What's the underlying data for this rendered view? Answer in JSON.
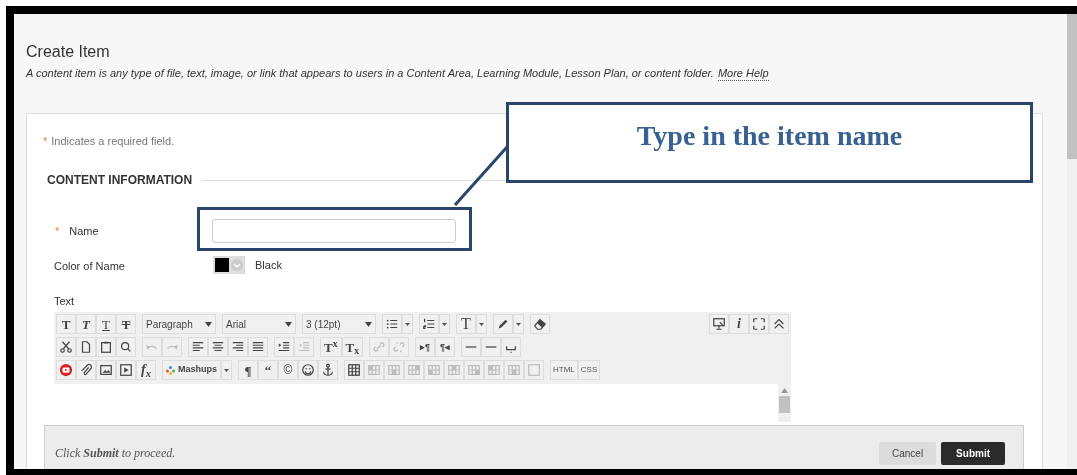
{
  "page": {
    "title": "Create Item",
    "description": "A content item is any type of file, text, image, or link that appears to users in a Content Area, Learning Module, Lesson Plan, or content folder.",
    "help_link": "More Help"
  },
  "form": {
    "required_mark": "*",
    "required_note": "Indicates a required field.",
    "section_title": "CONTENT INFORMATION",
    "name_field": {
      "required_mark": "*",
      "label": "Name"
    },
    "color_field": {
      "label": "Color of Name",
      "color": "#000000",
      "value": "Black"
    },
    "text_field": {
      "label": "Text"
    }
  },
  "toolbar": {
    "rows": [
      {
        "left": [
          {
            "items": [
              {
                "kind": "glyph",
                "text": "T"
              },
              {
                "kind": "glyph",
                "text": "T"
              },
              {
                "kind": "glyph",
                "text": "T"
              },
              {
                "kind": "glyph",
                "text": "T"
              }
            ]
          },
          {
            "items": [
              {
                "kind": "dropdown",
                "text": "Paragraph"
              }
            ]
          },
          {
            "items": [
              {
                "kind": "dropdown",
                "text": "Arial"
              }
            ]
          },
          {
            "items": [
              {
                "kind": "dropdown",
                "text": "3 (12pt)"
              }
            ]
          },
          {
            "items": [
              {
                "kind": "icon",
                "disabled": false
              },
              {
                "kind": "caret"
              }
            ]
          },
          {
            "items": [
              {
                "kind": "icon",
                "disabled": false
              },
              {
                "kind": "caret"
              }
            ]
          },
          {
            "items": [
              {
                "kind": "glyph",
                "text": "T"
              },
              {
                "kind": "caret"
              }
            ]
          },
          {
            "items": [
              {
                "kind": "icon",
                "disabled": false
              },
              {
                "kind": "caret"
              }
            ]
          },
          {
            "items": [
              {
                "kind": "icon",
                "disabled": false
              }
            ]
          }
        ],
        "right": [
          {
            "items": [
              {
                "kind": "icon",
                "disabled": false
              },
              {
                "kind": "glyph",
                "text": "i"
              },
              {
                "kind": "icon",
                "disabled": false
              },
              {
                "kind": "icon",
                "disabled": false
              }
            ]
          }
        ]
      },
      {
        "left": [
          {
            "items": [
              {
                "kind": "icon",
                "disabled": false
              },
              {
                "kind": "icon",
                "disabled": false
              },
              {
                "kind": "icon",
                "disabled": false
              },
              {
                "kind": "icon",
                "disabled": false
              }
            ]
          },
          {
            "items": [
              {
                "kind": "icon",
                "disabled": true
              },
              {
                "kind": "icon",
                "disabled": true
              }
            ]
          },
          {
            "items": [
              {
                "kind": "icon",
                "disabled": false
              },
              {
                "kind": "icon",
                "disabled": false
              },
              {
                "kind": "icon",
                "disabled": false
              },
              {
                "kind": "icon",
                "disabled": false
              }
            ]
          },
          {
            "items": [
              {
                "kind": "icon",
                "disabled": false
              },
              {
                "kind": "icon",
                "disabled": true
              }
            ]
          },
          {
            "items": [
              {
                "kind": "glyph",
                "text": "T$^{x}$"
              },
              {
                "kind": "glyph",
                "text": "T$_{x}$"
              }
            ]
          },
          {
            "items": [
              {
                "kind": "icon",
                "disabled": true
              },
              {
                "kind": "icon",
                "disabled": true
              }
            ]
          },
          {
            "items": [
              {
                "kind": "glyph",
                "text": "▸¶"
              },
              {
                "kind": "glyph",
                "text": "¶◂"
              }
            ]
          },
          {
            "items": [
              {
                "kind": "icon",
                "disabled": false
              },
              {
                "kind": "icon",
                "disabled": false
              },
              {
                "kind": "icon",
                "disabled": false
              }
            ]
          }
        ],
        "right": []
      },
      {
        "left": [
          {
            "items": [
              {
                "kind": "icon",
                "disabled": false
              },
              {
                "kind": "icon",
                "disabled": false
              },
              {
                "kind": "icon",
                "disabled": false
              },
              {
                "kind": "icon",
                "disabled": false
              },
              {
                "kind": "glyph",
                "text": "f$_{x}$"
              }
            ]
          },
          {
            "items": [
              {
                "kind": "mashups_dropdown",
                "text": "Mashups"
              },
              {
                "kind": "caret"
              }
            ]
          },
          {
            "items": [
              {
                "kind": "glyph",
                "text": "¶"
              },
              {
                "kind": "glyph",
                "text": "“"
              },
              {
                "kind": "glyph",
                "text": "©"
              },
              {
                "kind": "icon",
                "disabled": false
              },
              {
                "kind": "icon",
                "disabled": false
              }
            ]
          },
          {
            "items": [
              {
                "kind": "icon",
                "disabled": false
              },
              {
                "kind": "icon",
                "disabled": true
              },
              {
                "kind": "icon",
                "disabled": true
              },
              {
                "kind": "icon",
                "disabled": true
              },
              {
                "kind": "icon",
                "disabled": true
              },
              {
                "kind": "icon",
                "disabled": true
              },
              {
                "kind": "icon",
                "disabled": true
              },
              {
                "kind": "icon",
                "disabled": true
              },
              {
                "kind": "icon",
                "disabled": true
              },
              {
                "kind": "icon",
                "disabled": true
              }
            ]
          },
          {
            "items": [
              {
                "kind": "text_button",
                "text": "HTML"
              },
              {
                "kind": "text_button",
                "text": "CSS"
              }
            ]
          }
        ],
        "right": []
      }
    ]
  },
  "footer": {
    "instruction": "Click **Submit** to proceed.",
    "buttons": [
      {
        "label": "Cancel",
        "kind": "secondary"
      },
      {
        "label": "Submit",
        "kind": "primary"
      }
    ]
  },
  "callout": {
    "text": "Type in the item name"
  }
}
